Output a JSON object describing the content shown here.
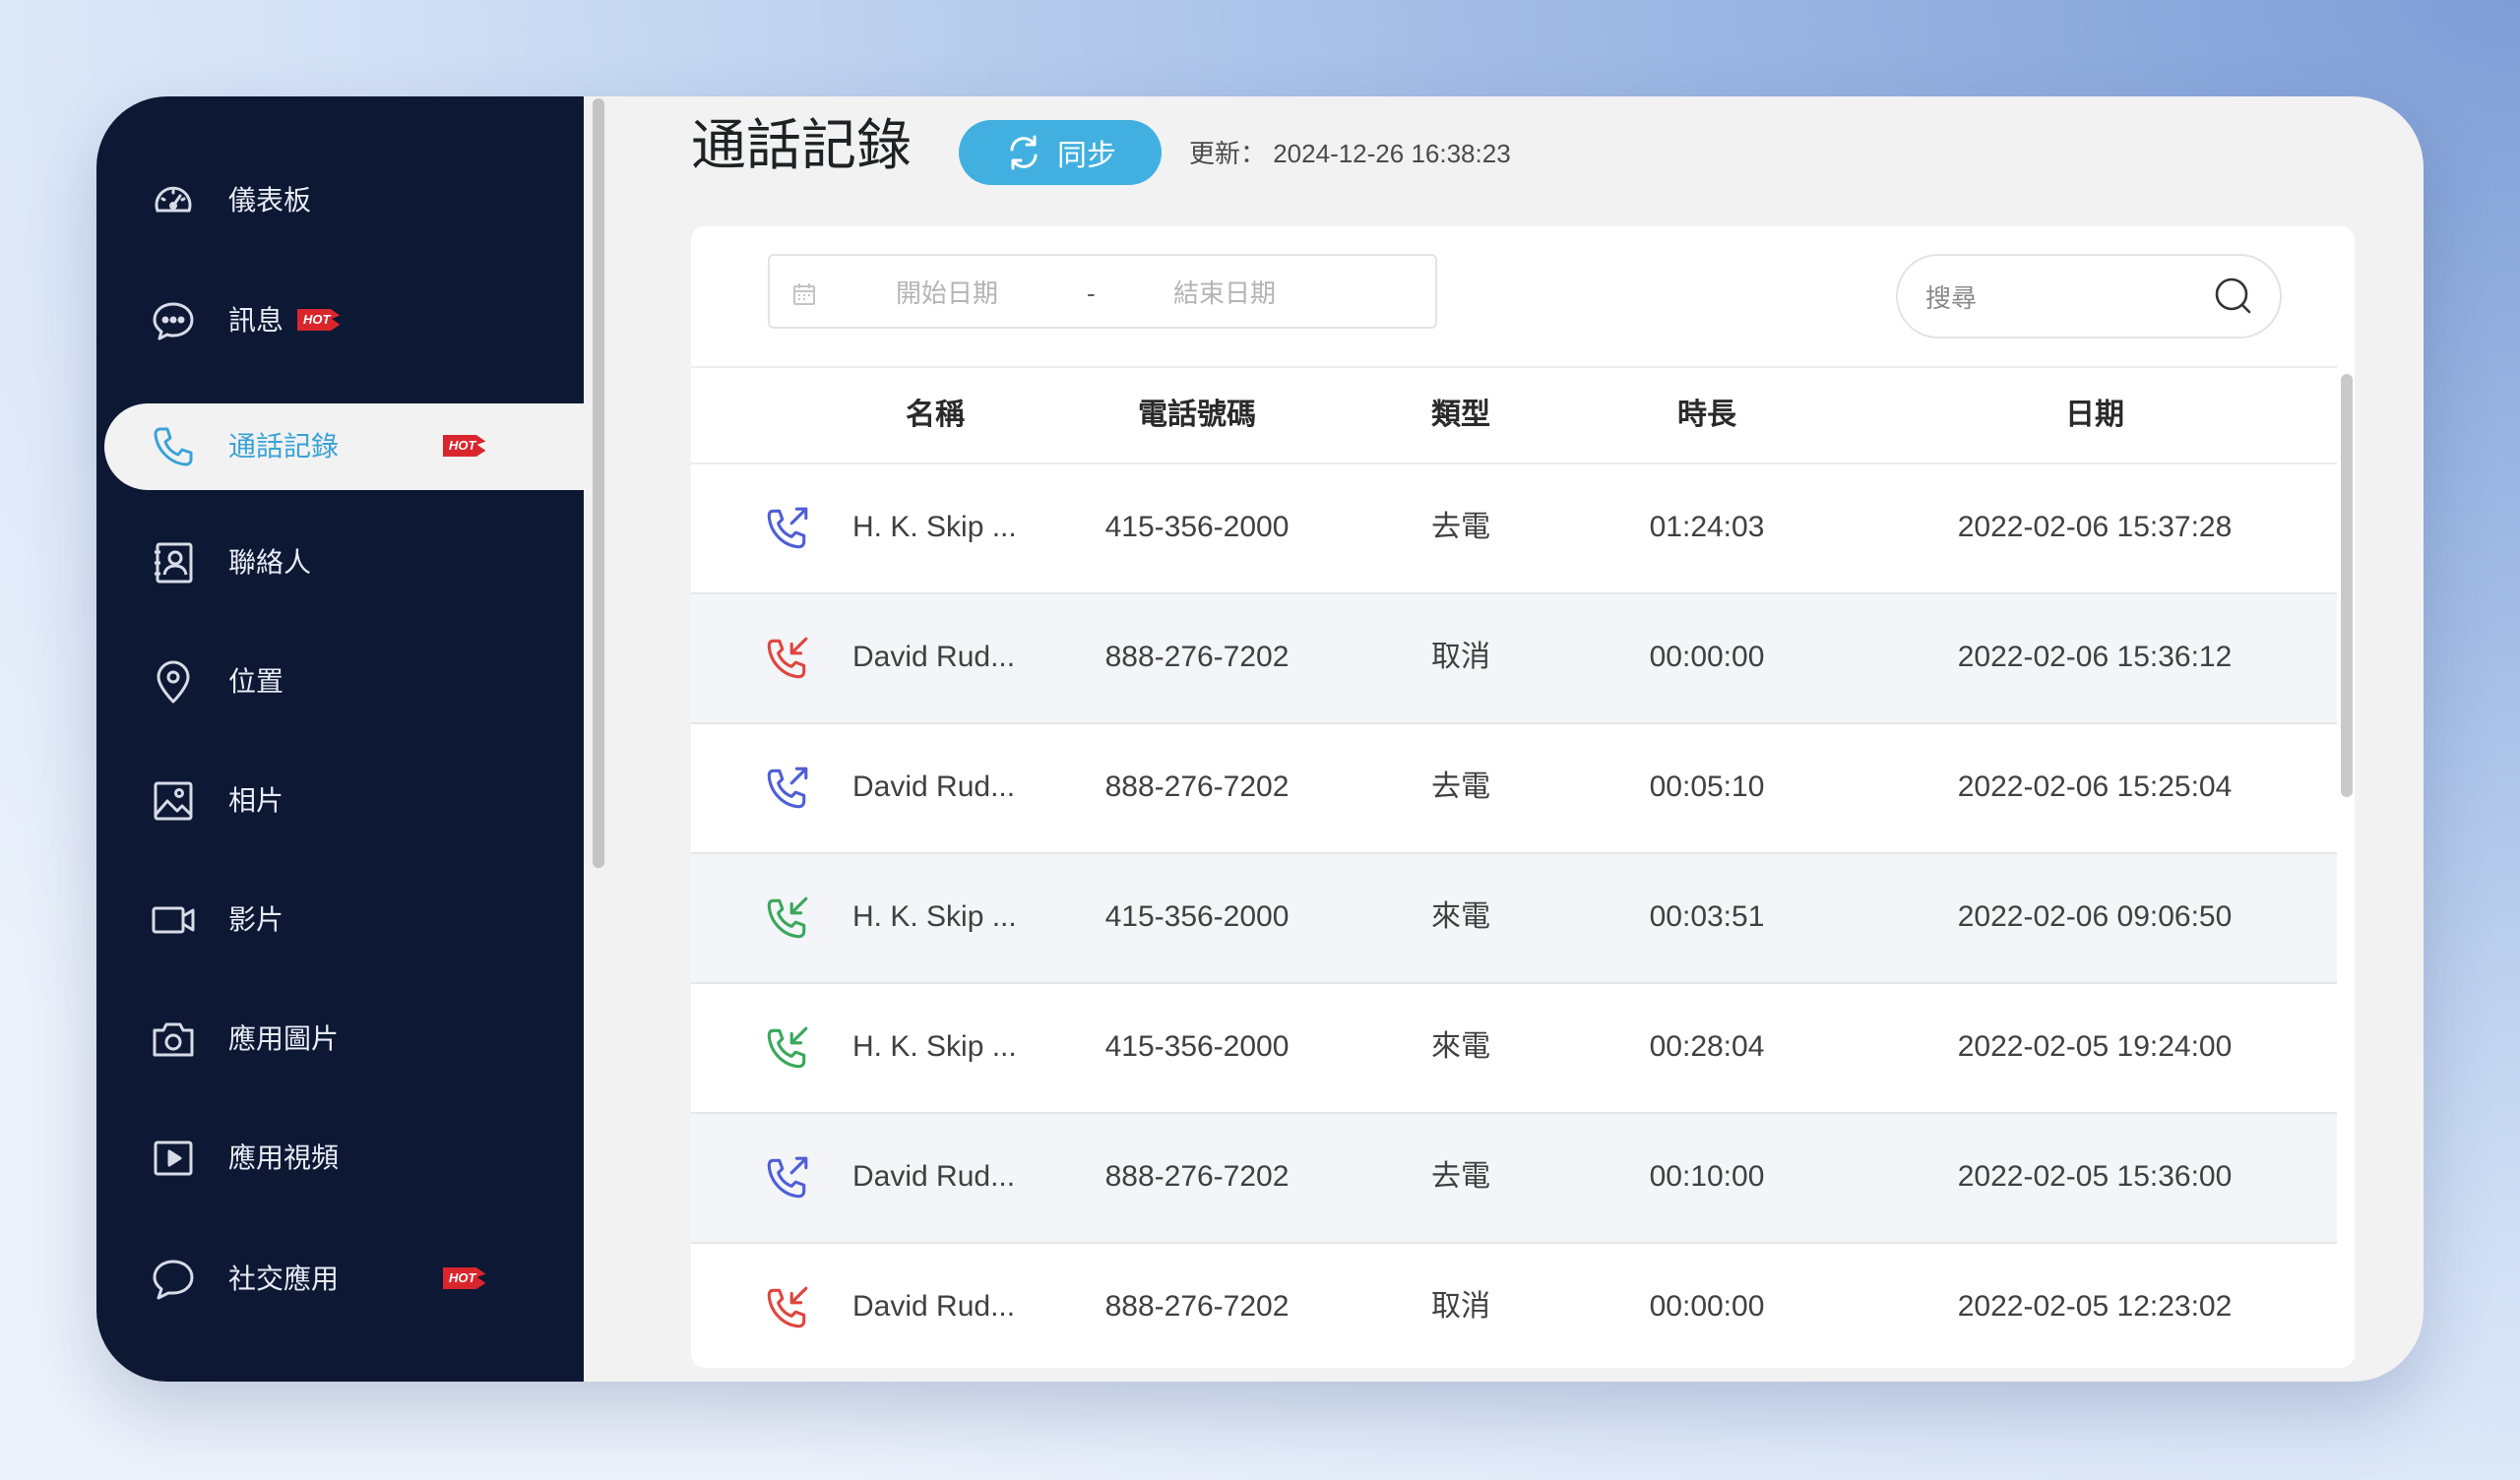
{
  "sidebar": {
    "items": [
      {
        "label": "儀表板",
        "icon": "dashboard-icon"
      },
      {
        "label": "訊息",
        "icon": "message-icon",
        "badge": "HOT"
      },
      {
        "label": "通話記錄",
        "icon": "phone-icon",
        "badge": "HOT",
        "active": true
      },
      {
        "label": "聯絡人",
        "icon": "contacts-icon"
      },
      {
        "label": "位置",
        "icon": "location-icon"
      },
      {
        "label": "相片",
        "icon": "photo-icon"
      },
      {
        "label": "影片",
        "icon": "video-icon"
      },
      {
        "label": "應用圖片",
        "icon": "camera-icon"
      },
      {
        "label": "應用視頻",
        "icon": "play-icon"
      },
      {
        "label": "社交應用",
        "icon": "chat-bubble-icon",
        "badge": "HOT"
      }
    ]
  },
  "header": {
    "title": "通話記錄",
    "sync_label": "同步",
    "update_text": "更新： 2024-12-26 16:38:23"
  },
  "filters": {
    "start_placeholder": "開始日期",
    "separator": "-",
    "end_placeholder": "結束日期",
    "search_placeholder": "搜尋"
  },
  "table": {
    "columns": [
      "名稱",
      "電話號碼",
      "類型",
      "時長",
      "日期"
    ],
    "rows": [
      {
        "direction": "outgoing",
        "name": "H. K. Skip ...",
        "phone": "415-356-2000",
        "type": "去電",
        "duration": "01:24:03",
        "date": "2022-02-06 15:37:28"
      },
      {
        "direction": "missed",
        "name": "David Rud...",
        "phone": "888-276-7202",
        "type": "取消",
        "duration": "00:00:00",
        "date": "2022-02-06 15:36:12"
      },
      {
        "direction": "outgoing",
        "name": "David Rud...",
        "phone": "888-276-7202",
        "type": "去電",
        "duration": "00:05:10",
        "date": "2022-02-06 15:25:04"
      },
      {
        "direction": "incoming",
        "name": "H. K. Skip ...",
        "phone": "415-356-2000",
        "type": "來電",
        "duration": "00:03:51",
        "date": "2022-02-06 09:06:50"
      },
      {
        "direction": "incoming",
        "name": "H. K. Skip ...",
        "phone": "415-356-2000",
        "type": "來電",
        "duration": "00:28:04",
        "date": "2022-02-05 19:24:00"
      },
      {
        "direction": "outgoing",
        "name": "David Rud...",
        "phone": "888-276-7202",
        "type": "去電",
        "duration": "00:10:00",
        "date": "2022-02-05 15:36:00"
      },
      {
        "direction": "missed",
        "name": "David Rud...",
        "phone": "888-276-7202",
        "type": "取消",
        "duration": "00:00:00",
        "date": "2022-02-05 12:23:02"
      }
    ]
  },
  "colors": {
    "sidebar_bg": "#0d1834",
    "accent": "#41b0e0",
    "outgoing": "#4f5fd6",
    "missed": "#e0453f",
    "incoming": "#3aa85a",
    "hot_badge": "#d9262d"
  }
}
